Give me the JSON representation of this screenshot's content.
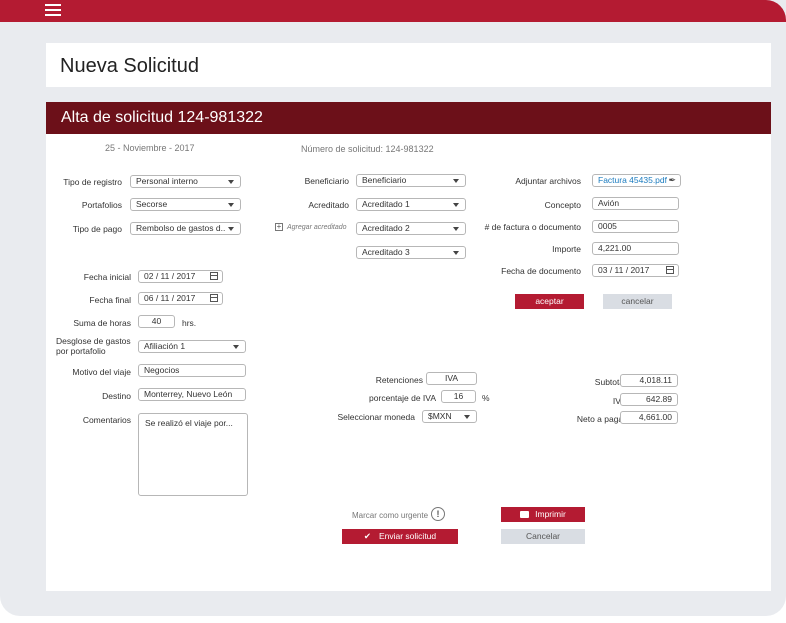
{
  "page_title": "Nueva Solicitud",
  "panel_title": "Alta de solicitud 124-981322",
  "date_text": "25 - Noviembre - 2017",
  "request_number_text": "Número de solicitud: 124-981322",
  "left": {
    "tipo_registro": {
      "label": "Tipo de registro",
      "value": "Personal interno"
    },
    "portafolios": {
      "label": "Portafolios",
      "value": "Secorse"
    },
    "tipo_pago": {
      "label": "Tipo de pago",
      "value": "Rembolso de gastos d..."
    },
    "fecha_inicial": {
      "label": "Fecha inicial",
      "value": "02 / 11 / 2017"
    },
    "fecha_final": {
      "label": "Fecha final",
      "value": "06 / 11 / 2017"
    },
    "suma_horas": {
      "label": "Suma de horas",
      "value": "40",
      "unit": "hrs."
    },
    "desglose": {
      "label_line1": "Desglose de gastos",
      "label_line2": "por portafolio",
      "value": "Afiliación 1"
    },
    "motivo": {
      "label": "Motivo del viaje",
      "value": "Negocios"
    },
    "destino": {
      "label": "Destino",
      "value": "Monterrey, Nuevo León"
    },
    "comentarios": {
      "label": "Comentarios",
      "value": "Se realizó el viaje por..."
    }
  },
  "middle": {
    "beneficiario": {
      "label": "Beneficiario",
      "value": "Beneficiario"
    },
    "acreditado": {
      "label": "Acreditado",
      "value": "Acreditado 1"
    },
    "agregar_acreditado": "Agregar acreditado",
    "acreditado2": "Acreditado 2",
    "acreditado3": "Acreditado 3",
    "retenciones": {
      "label": "Retenciones",
      "value": "IVA"
    },
    "porcentaje_iva": {
      "label": "porcentaje de IVA",
      "value": "16",
      "unit": "%"
    },
    "moneda": {
      "label": "Seleccionar moneda",
      "value": "$MXN"
    }
  },
  "right": {
    "adjuntar": {
      "label": "Adjuntar archivos",
      "value": "Factura 45435.pdf"
    },
    "concepto": {
      "label": "Concepto",
      "value": "Avión"
    },
    "factura": {
      "label": "# de factura o documento",
      "value": "0005"
    },
    "importe": {
      "label": "Importe",
      "value": "4,221.00"
    },
    "fecha_doc": {
      "label": "Fecha de documento",
      "value": "03 / 11 / 2017"
    },
    "aceptar_label": "aceptar",
    "cancelar_label": "cancelar",
    "subtotal": {
      "label": "Subtotal",
      "value": "4,018.11"
    },
    "iva": {
      "label": "IVA",
      "value": "642.89"
    },
    "neto": {
      "label": "Neto a pagar",
      "value": "4,661.00"
    }
  },
  "footer": {
    "urgente_label": "Marcar como urgente",
    "imprimir_label": "Imprimir",
    "enviar_label": "Enviar solicitud",
    "cancelar_label": "Cancelar"
  },
  "colors": {
    "accent": "#b41b32",
    "header_dark": "#6c1019",
    "background": "#e9ebef",
    "link": "#1a7bbf"
  }
}
